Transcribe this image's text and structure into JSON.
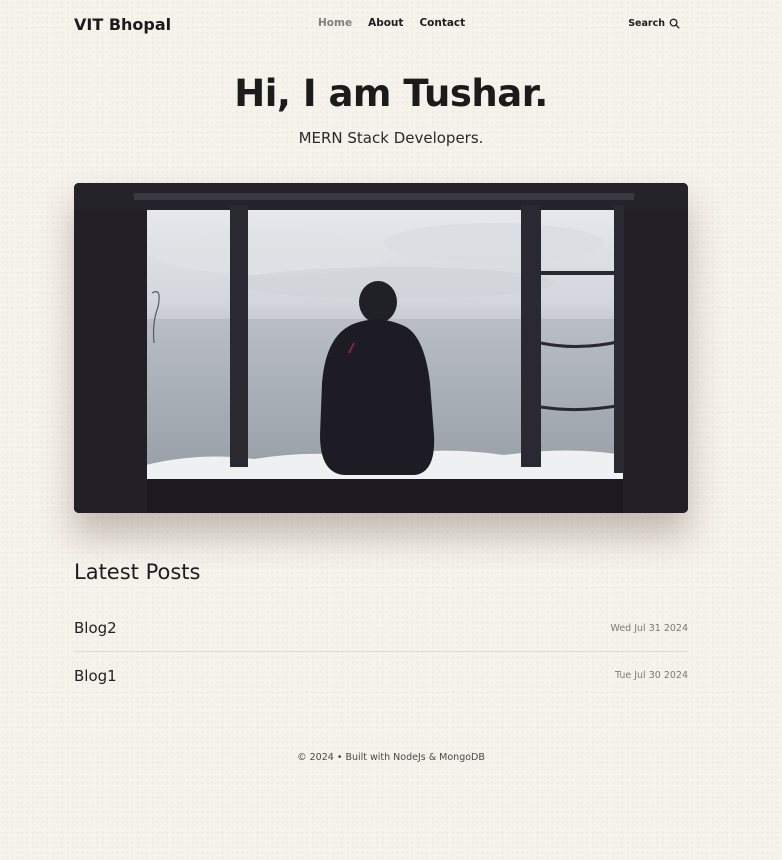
{
  "header": {
    "logo": "VIT Bhopal",
    "nav": [
      {
        "label": "Home",
        "active": true
      },
      {
        "label": "About",
        "active": false
      },
      {
        "label": "Contact",
        "active": false
      }
    ],
    "search_label": "Search"
  },
  "hero": {
    "title": "Hi, I am Tushar.",
    "subtitle": "MERN Stack Developers."
  },
  "posts": {
    "heading": "Latest Posts",
    "items": [
      {
        "title": "Blog2",
        "date": "Wed Jul 31 2024"
      },
      {
        "title": "Blog1",
        "date": "Tue Jul 30 2024"
      }
    ]
  },
  "footer": {
    "text": "© 2024 • Built with NodeJs & MongoDB"
  },
  "colors": {
    "background": "#f6f2ec",
    "text": "#1d1d1f",
    "nav_active": "#808080"
  }
}
